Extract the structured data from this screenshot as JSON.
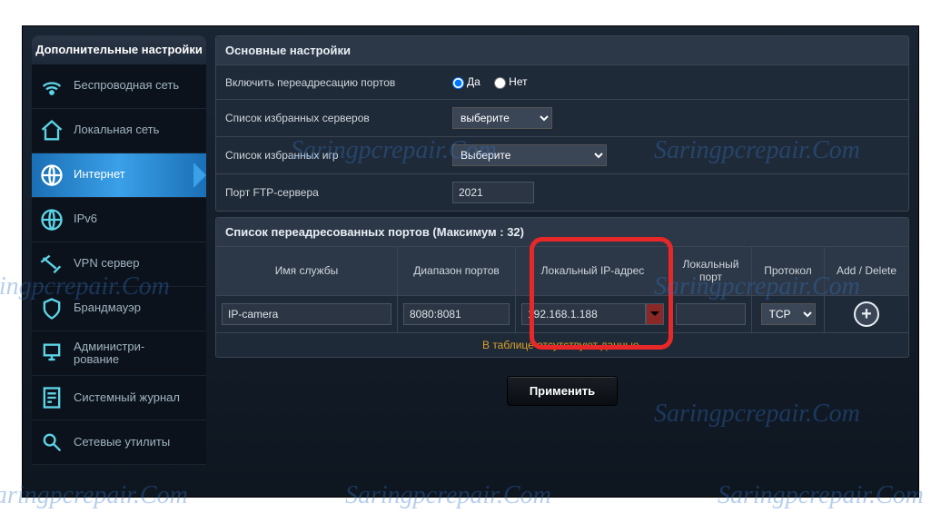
{
  "watermark_text": "Saringpcrepair.Com",
  "sidebar": {
    "header": "Дополнительные настройки",
    "items": [
      {
        "label": "Беспроводная сеть",
        "icon": "wifi"
      },
      {
        "label": "Локальная сеть",
        "icon": "home"
      },
      {
        "label": "Интернет",
        "icon": "globe",
        "active": true
      },
      {
        "label": "IPv6",
        "icon": "globe"
      },
      {
        "label": "VPN сервер",
        "icon": "vpn"
      },
      {
        "label": "Брандмауэр",
        "icon": "shield"
      },
      {
        "label": "Администри-\nрование",
        "icon": "admin"
      },
      {
        "label": "Системный журнал",
        "icon": "log"
      },
      {
        "label": "Сетевые утилиты",
        "icon": "tools"
      }
    ]
  },
  "main_settings": {
    "title": "Основные настройки",
    "rows": {
      "enable_forwarding": {
        "label": "Включить переадресацию портов",
        "yes": "Да",
        "no": "Нет",
        "value": "yes"
      },
      "favorite_servers": {
        "label": "Список избранных серверов",
        "placeholder": "выберите"
      },
      "favorite_games": {
        "label": "Список избранных игр",
        "placeholder": "Выберите"
      },
      "ftp_port": {
        "label": "Порт FTP-сервера",
        "value": "2021"
      }
    }
  },
  "port_table": {
    "title": "Список переадресованных портов (Максимум : 32)",
    "columns": {
      "service": "Имя службы",
      "range": "Диапазон портов",
      "local_ip": "Локальный IP-адрес",
      "local_port": "Локальный порт",
      "protocol": "Протокол",
      "action": "Add / Delete"
    },
    "row": {
      "service": "IP-camera",
      "range": "8080:8081",
      "local_ip": "192.168.1.188",
      "local_port": "",
      "protocol": "TCP"
    },
    "empty_message": "В таблице отсутствуют данные."
  },
  "apply_label": "Применить"
}
